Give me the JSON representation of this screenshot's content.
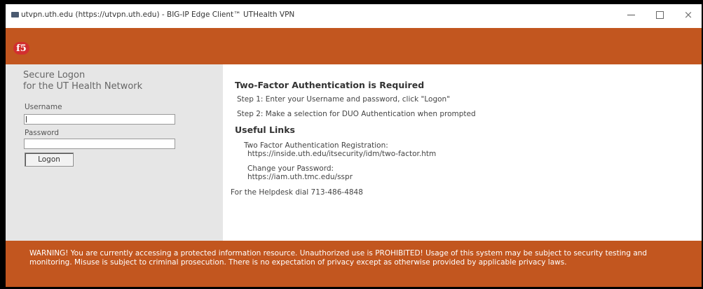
{
  "window": {
    "title": "utvpn.uth.edu (https://utvpn.uth.edu) - BIG-IP Edge Client™ UTHealth VPN",
    "minimize_glyph": "",
    "maximize_glyph": "",
    "close_glyph": "×"
  },
  "header": {
    "logo_text": "f5",
    "brand_color": "#c2561f"
  },
  "login": {
    "title_line1": "Secure Logon",
    "title_line2": "for the UT Health Network",
    "username_label": "Username",
    "username_value": "",
    "password_label": "Password",
    "password_value": "",
    "logon_label": "Logon"
  },
  "info": {
    "heading": "Two-Factor Authentication is Required",
    "step1": "Step 1: Enter your Username and password, click \"Logon\"",
    "step2": "Step 2: Make a selection for DUO Authentication when prompted",
    "links_heading": "Useful Links",
    "link1_label": "Two Factor Authentication Registration:",
    "link1_url": "https://inside.uth.edu/itsecurity/idm/two-factor.htm",
    "link2_label": "Change your Password:",
    "link2_url": "https://iam.uth.tmc.edu/sspr",
    "helpdesk": "For the Helpdesk dial 713-486-4848"
  },
  "warning": {
    "text": "WARNING! You are currently accessing a protected information resource. Unauthorized use is PROHIBITED! Usage of this system may be subject to security testing and monitoring. Misuse is subject to criminal prosecution. There is no expectation of privacy except as otherwise provided by applicable privacy laws."
  }
}
